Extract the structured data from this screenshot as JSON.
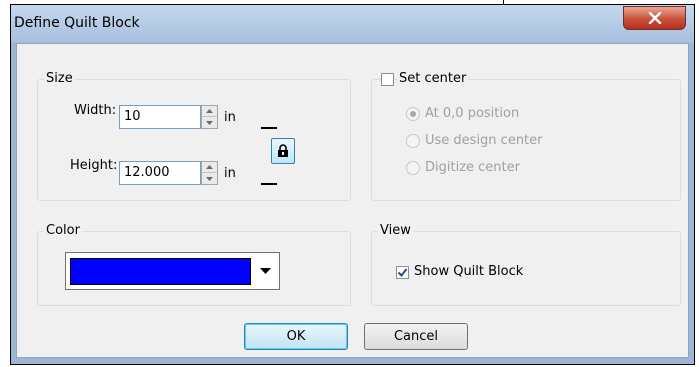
{
  "window": {
    "title": "Define Quilt Block"
  },
  "size_group": {
    "label": "Size",
    "width": {
      "label": "Width:",
      "value": "10",
      "unit": "in"
    },
    "height": {
      "label": "Height:",
      "value": "12.000",
      "unit": "in"
    }
  },
  "set_center_group": {
    "label": "Set center",
    "checked": false,
    "options": [
      {
        "label": "At 0,0 position",
        "selected": true
      },
      {
        "label": "Use design center",
        "selected": false
      },
      {
        "label": "Digitize center",
        "selected": false
      }
    ]
  },
  "color_group": {
    "label": "Color",
    "selected_color": "#0000ff"
  },
  "view_group": {
    "label": "View",
    "show_quilt_block": {
      "label": "Show Quilt Block",
      "checked": true
    }
  },
  "buttons": {
    "ok": "OK",
    "cancel": "Cancel"
  },
  "icons": [
    "close-icon",
    "spin-up-icon",
    "spin-down-icon",
    "lock-icon",
    "checkmark-icon",
    "dropdown-arrow-icon"
  ],
  "colors": {
    "title_bar": "#b9cde6",
    "close_button": "#c8503a",
    "dialog_face": "#f0f0f0",
    "swatch": "#0000ff"
  }
}
